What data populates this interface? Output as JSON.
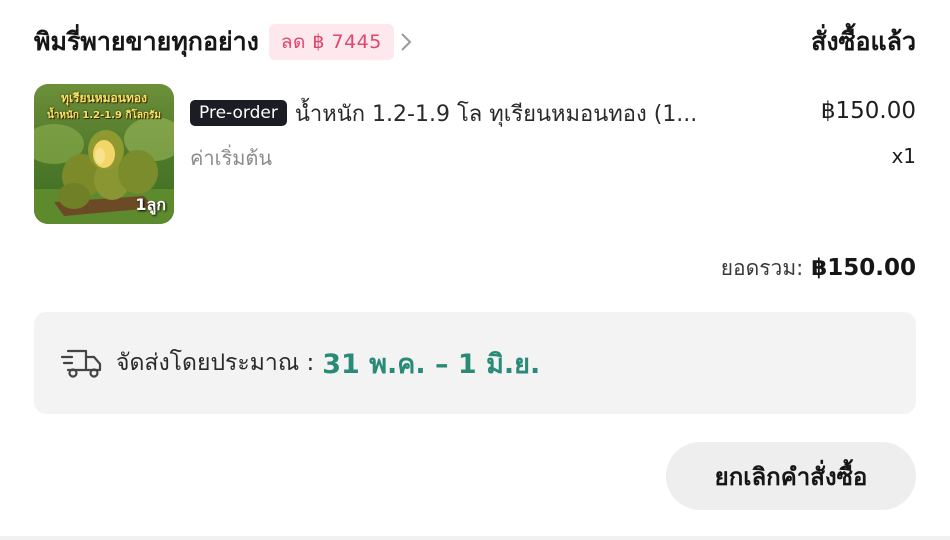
{
  "header": {
    "shop_name": "พิมรี่พายขายทุกอย่าง",
    "promo_badge": "ลด ฿ 7445",
    "status": "สั่งซื้อแล้ว"
  },
  "product": {
    "image_text_line1": "ทุเรียนหมอนทอง",
    "image_text_line2": "น้ำหนัก 1.2-1.9 กิโลกรัม",
    "image_quantity_text": "1ลูก",
    "preorder_badge": "Pre-order",
    "title": "น้ำหนัก 1.2-1.9 โล ทุเรียนหมอนทอง  (1...",
    "variant": "ค่าเริ่มต้น",
    "price": "฿150.00",
    "quantity": "x1"
  },
  "summary": {
    "total_label": "ยอดรวม:",
    "total_value": "฿150.00"
  },
  "delivery": {
    "icon": "delivery-truck-icon",
    "label": "จัดส่งโดยประมาณ :",
    "date_range": "31 พ.ค. – 1 มิ.ย.",
    "date_color": "#2a8a78"
  },
  "actions": {
    "cancel_label": "ยกเลิกคำสั่งซื้อ"
  },
  "colors": {
    "promo_text": "#e2466b",
    "promo_bg": "#fde8ee",
    "preorder_bg": "#1c1c24"
  }
}
